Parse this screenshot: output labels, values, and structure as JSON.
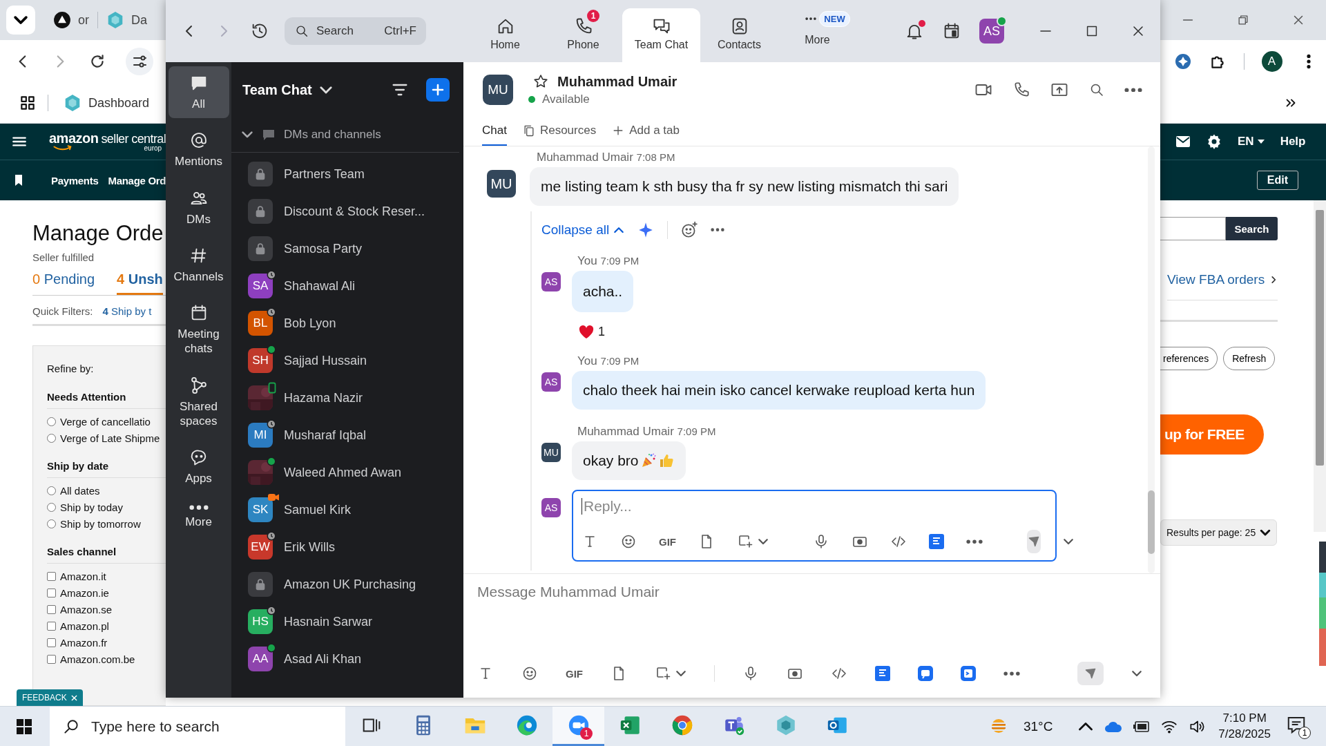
{
  "browser": {
    "tabs": [
      {
        "label": "or",
        "kind": "dark"
      },
      {
        "label": "Da",
        "kind": "hex"
      }
    ],
    "bookmarks": [
      {
        "label": "Dashboard"
      }
    ],
    "profile": "A"
  },
  "amazon": {
    "logo": "amazon",
    "logo_sub": "seller central",
    "logo_region": "europ",
    "nav": [
      "Payments",
      "Manage Ord"
    ],
    "lang": "EN",
    "help": "Help",
    "edit": "Edit",
    "title": "Manage Orde",
    "subtitle": "Seller fulfilled",
    "tabs": [
      {
        "count": "0",
        "label": "Pending",
        "selected": false
      },
      {
        "count": "4",
        "label": "Unsh",
        "selected": true
      }
    ],
    "quick_filters_label": "Quick Filters:",
    "quick_filters": [
      {
        "count": "4",
        "label": "Ship by t"
      }
    ],
    "refine_label": "Refine by:",
    "filter_groups": [
      {
        "title": "Needs Attention",
        "kind": "radio",
        "options": [
          {
            "label": "Verge of cancellatio",
            "checked": false
          },
          {
            "label": "Verge of Late Shipme",
            "checked": false
          }
        ]
      },
      {
        "title": "Ship by date",
        "kind": "radio",
        "options": [
          {
            "label": "All dates",
            "checked": false
          },
          {
            "label": "Ship by today",
            "checked": false
          },
          {
            "label": "Ship by tomorrow",
            "checked": false
          }
        ]
      },
      {
        "title": "Sales channel",
        "kind": "checkbox",
        "options": [
          {
            "label": "Amazon.it",
            "checked": false
          },
          {
            "label": "Amazon.ie",
            "checked": false
          },
          {
            "label": "Amazon.se",
            "checked": false
          },
          {
            "label": "Amazon.pl",
            "checked": false
          },
          {
            "label": "Amazon.fr",
            "checked": false
          },
          {
            "label": "Amazon.com.be",
            "checked": false
          }
        ]
      }
    ],
    "search_button": "Search",
    "fba_link": "View FBA orders",
    "preferences_button": "references",
    "refresh_button": "Refresh",
    "signup_button": "up for FREE",
    "results_per_page": "Results per page: 25",
    "feedback": "FEEDBACK"
  },
  "zoom": {
    "forward_disabled": true,
    "search": {
      "placeholder": "Search",
      "shortcut": "Ctrl+F"
    },
    "nav_tabs": [
      {
        "label": "Home",
        "kind": "home",
        "selected": false
      },
      {
        "label": "Phone",
        "kind": "phone",
        "badge": "1",
        "selected": false
      },
      {
        "label": "Team Chat",
        "kind": "chat",
        "selected": true
      },
      {
        "label": "Contacts",
        "kind": "contacts",
        "selected": false
      },
      {
        "label": "More",
        "kind": "more",
        "badge": "NEW",
        "selected": false
      }
    ],
    "notifications_unread": true,
    "user": {
      "initials": "AS",
      "online": true
    },
    "rail": [
      {
        "label": "All",
        "kind": "all",
        "selected": true
      },
      {
        "label": "Mentions",
        "kind": "mentions",
        "selected": false
      },
      {
        "label": "DMs",
        "kind": "dms",
        "selected": false
      },
      {
        "label": "Channels",
        "kind": "channels",
        "selected": false
      },
      {
        "label": "Meeting chats",
        "kind": "meetings",
        "selected": false
      },
      {
        "label": "Shared spaces",
        "kind": "shared",
        "selected": false
      },
      {
        "label": "Apps",
        "kind": "apps",
        "selected": false
      },
      {
        "label": "More",
        "kind": "more",
        "selected": false
      }
    ],
    "chat_list": {
      "title": "Team Chat",
      "section": {
        "label": "DMs and channels",
        "expanded": true,
        "items": [
          {
            "kind": "channel",
            "name": "Partners Team"
          },
          {
            "kind": "channel",
            "name": "Discount & Stock Reser..."
          },
          {
            "kind": "channel",
            "name": "Samosa Party"
          },
          {
            "kind": "away",
            "initials": "SA",
            "color": "#8e3fbf",
            "name": "Shahawal Ali"
          },
          {
            "kind": "away",
            "initials": "BL",
            "color": "#d35400",
            "name": "Bob Lyon"
          },
          {
            "kind": "online",
            "initials": "SH",
            "color": "#c0392b",
            "name": "Sajjad Hussain"
          },
          {
            "kind": "mobile",
            "name": "Hazama Nazir"
          },
          {
            "kind": "away",
            "initials": "MI",
            "color": "#2b7bc0",
            "name": "Musharaf Iqbal"
          },
          {
            "kind": "online",
            "name": "Waleed Ahmed Awan"
          },
          {
            "kind": "meeting",
            "initials": "SK",
            "color": "#2e86c1",
            "name": "Samuel Kirk"
          },
          {
            "kind": "away",
            "initials": "EW",
            "color": "#c8382b",
            "name": "Erik Wills"
          },
          {
            "kind": "channel",
            "name": "Amazon UK Purchasing"
          },
          {
            "kind": "away",
            "initials": "HS",
            "color": "#27ae60",
            "name": "Hasnain Sarwar"
          },
          {
            "kind": "online",
            "initials": "AA",
            "color": "#8e44ad",
            "name": "Asad Ali Khan"
          }
        ]
      }
    },
    "conversation": {
      "initials": "MU",
      "name": "Muhammad Umair",
      "starred": false,
      "online": true,
      "status": "Available",
      "tabs": [
        {
          "label": "Chat",
          "kind": "chat",
          "selected": true
        },
        {
          "label": "Resources",
          "kind": "resources",
          "selected": false
        }
      ],
      "add_tab": "Add a tab",
      "message": {
        "sender": "Muhammad Umair",
        "time": "7:08 PM",
        "initials": "MU",
        "text": "me listing team k sth busy tha fr sy new listing mismatch thi sari"
      },
      "thread": {
        "collapse": "Collapse all",
        "replies": [
          {
            "sender": "You",
            "time": "7:09 PM",
            "initials": "AS",
            "mine": true,
            "text": "acha..",
            "reactions": [
              {
                "kind": "heart",
                "count": "1"
              }
            ]
          },
          {
            "sender": "You",
            "time": "7:09 PM",
            "initials": "AS",
            "mine": true,
            "text": "chalo theek hai mein isko cancel kerwake reupload kerta hun"
          },
          {
            "sender": "Muhammad Umair",
            "time": "7:09 PM",
            "initials": "MU",
            "mine": false,
            "text": "okay bro",
            "emoji": [
              {
                "kind": "party"
              },
              {
                "kind": "thumbs_up"
              }
            ]
          }
        ],
        "reply_placeholder": "Reply...",
        "reply_initials": "AS",
        "reply_gif_label": "GIF"
      },
      "composer_placeholder": "Message Muhammad Umair",
      "gif_label": "GIF"
    }
  },
  "taskbar": {
    "search_placeholder": "Type here to search",
    "apps": [
      {
        "kind": "taskview",
        "active": false
      },
      {
        "kind": "calculator",
        "active": false
      },
      {
        "kind": "explorer",
        "active": false
      },
      {
        "kind": "edge",
        "active": false
      },
      {
        "kind": "zoom",
        "badge": "1",
        "active": true
      },
      {
        "kind": "excel",
        "active": false
      },
      {
        "kind": "chrome",
        "active": false
      },
      {
        "kind": "teams",
        "active": false
      },
      {
        "kind": "hexapp",
        "active": false
      },
      {
        "kind": "outlook",
        "active": false
      }
    ],
    "weather": "31°C",
    "time": "7:10 PM",
    "date": "7/28/2025",
    "notifications": "1"
  }
}
